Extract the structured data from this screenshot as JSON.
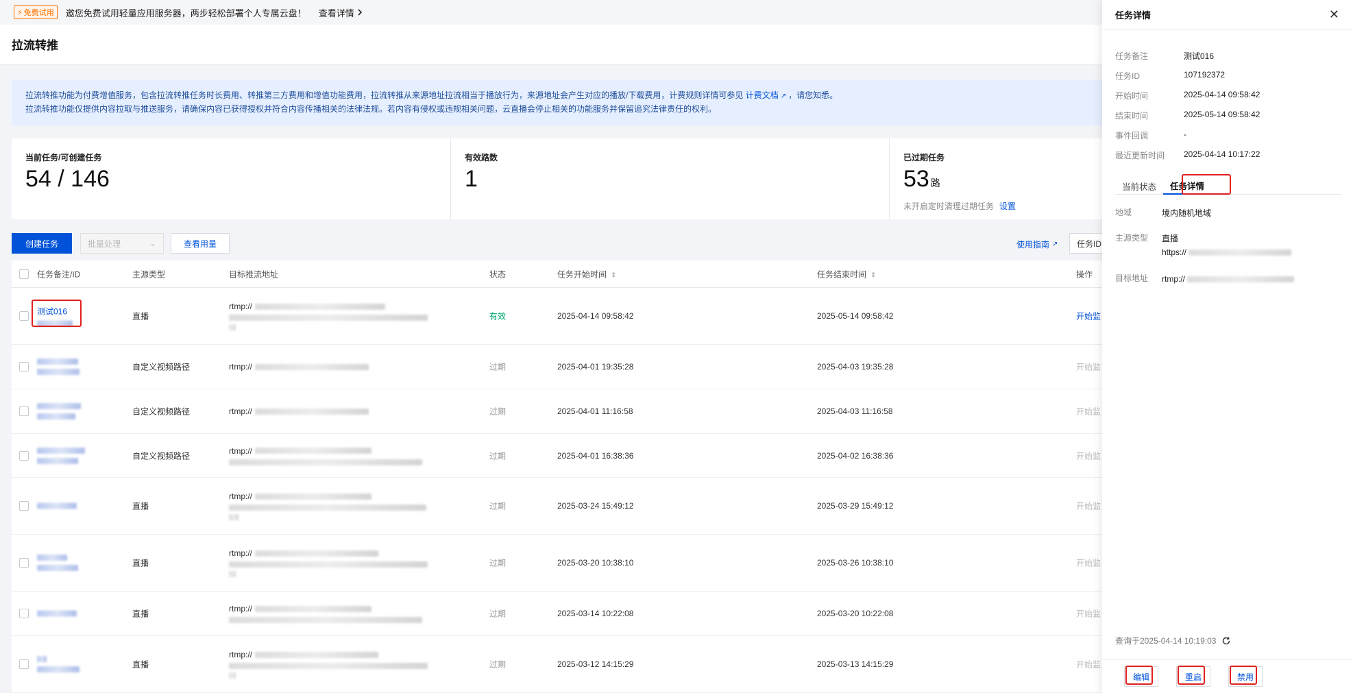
{
  "banner": {
    "badge": "免费试用",
    "text": "邀您免费试用轻量应用服务器，两步轻松部署个人专属云盘！",
    "link": "查看详情"
  },
  "page_title": "拉流转推",
  "notice": {
    "line1_pre": "拉流转推功能为付费增值服务，包含拉流转推任务时长费用、转推第三方费用和增值功能费用，拉流转推从来源地址拉流相当于播放行为，来源地址会产生对应的播放/下载费用，计费规则详情可参见 ",
    "line1_link": "计费文档",
    "line1_post": "，请您知悉。",
    "line2": "拉流转推功能仅提供内容拉取与推送服务，请确保内容已获得授权并符合内容传播相关的法律法规。若内容有侵权或违规相关问题，云直播会停止相关的功能服务并保留追究法律责任的权利。"
  },
  "stats": {
    "tasks_label": "当前任务/可创建任务",
    "tasks_value": "54 / 146",
    "valid_label": "有效路数",
    "valid_value": "1",
    "expired_label": "已过期任务",
    "expired_value": "53",
    "expired_unit": "路",
    "expired_note": "未开启定时清理过期任务",
    "expired_link": "设置"
  },
  "toolbar": {
    "create": "创建任务",
    "batch": "批量处理",
    "usage": "查看用量",
    "guide": "使用指南",
    "search_prefix": "任务ID"
  },
  "table": {
    "headers": {
      "name": "任务备注/ID",
      "source": "主源类型",
      "target": "目标推流地址",
      "status": "状态",
      "start": "任务开始时间",
      "end": "任务结束时间",
      "op": "操作"
    },
    "rows": [
      {
        "name": "测试016",
        "source": "直播",
        "url_prefix": "rtmp://",
        "status": "有效",
        "start": "2025-04-14 09:58:42",
        "end": "2025-05-14 09:58:42",
        "op": "开始监"
      },
      {
        "name": "",
        "source": "自定义视频路径",
        "url_prefix": "rtmp://",
        "status": "过期",
        "start": "2025-04-01 19:35:28",
        "end": "2025-04-03 19:35:28",
        "op": "开始监"
      },
      {
        "name": "",
        "source": "自定义视频路径",
        "url_prefix": "rtmp://",
        "status": "过期",
        "start": "2025-04-01 11:16:58",
        "end": "2025-04-03 11:16:58",
        "op": "开始监"
      },
      {
        "name": "",
        "source": "自定义视频路径",
        "url_prefix": "rtmp://",
        "status": "过期",
        "start": "2025-04-01 16:38:36",
        "end": "2025-04-02 16:38:36",
        "op": "开始监"
      },
      {
        "name": "",
        "source": "直播",
        "url_prefix": "rtmp://",
        "status": "过期",
        "start": "2025-03-24 15:49:12",
        "end": "2025-03-29 15:49:12",
        "op": "开始监"
      },
      {
        "name": "",
        "source": "直播",
        "url_prefix": "rtmp://",
        "status": "过期",
        "start": "2025-03-20 10:38:10",
        "end": "2025-03-26 10:38:10",
        "op": "开始监"
      },
      {
        "name": "",
        "source": "直播",
        "url_prefix": "rtmp://",
        "status": "过期",
        "start": "2025-03-14 10:22:08",
        "end": "2025-03-20 10:22:08",
        "op": "开始监"
      },
      {
        "name": "",
        "source": "直播",
        "url_prefix": "rtmp://",
        "status": "过期",
        "start": "2025-03-12 14:15:29",
        "end": "2025-03-13 14:15:29",
        "op": "开始监"
      }
    ]
  },
  "drawer": {
    "title": "任务详情",
    "fields": [
      {
        "k": "任务备注",
        "v": "测试016"
      },
      {
        "k": "任务ID",
        "v": "107192372"
      },
      {
        "k": "开始时间",
        "v": "2025-04-14 09:58:42"
      },
      {
        "k": "结束时间",
        "v": "2025-05-14 09:58:42"
      },
      {
        "k": "事件回调",
        "v": "-"
      },
      {
        "k": "最近更新时间",
        "v": "2025-04-14 10:17:22"
      }
    ],
    "tabs": [
      "当前状态",
      "任务详情"
    ],
    "details": {
      "region_k": "地域",
      "region_v": "境内随机地域",
      "source_k": "主源类型",
      "source_v": "直播",
      "source_url_prefix": "https://",
      "target_k": "目标地址",
      "target_url_prefix": "rtmp://"
    },
    "query_time": "查询于2025-04-14 10:19:03",
    "buttons": {
      "edit": "编辑",
      "restart": "重启",
      "disable": "禁用"
    }
  },
  "colors": {
    "primary": "#0052d9",
    "success": "#00a870",
    "highlight": "#e02020",
    "badge": "#ff7200"
  }
}
